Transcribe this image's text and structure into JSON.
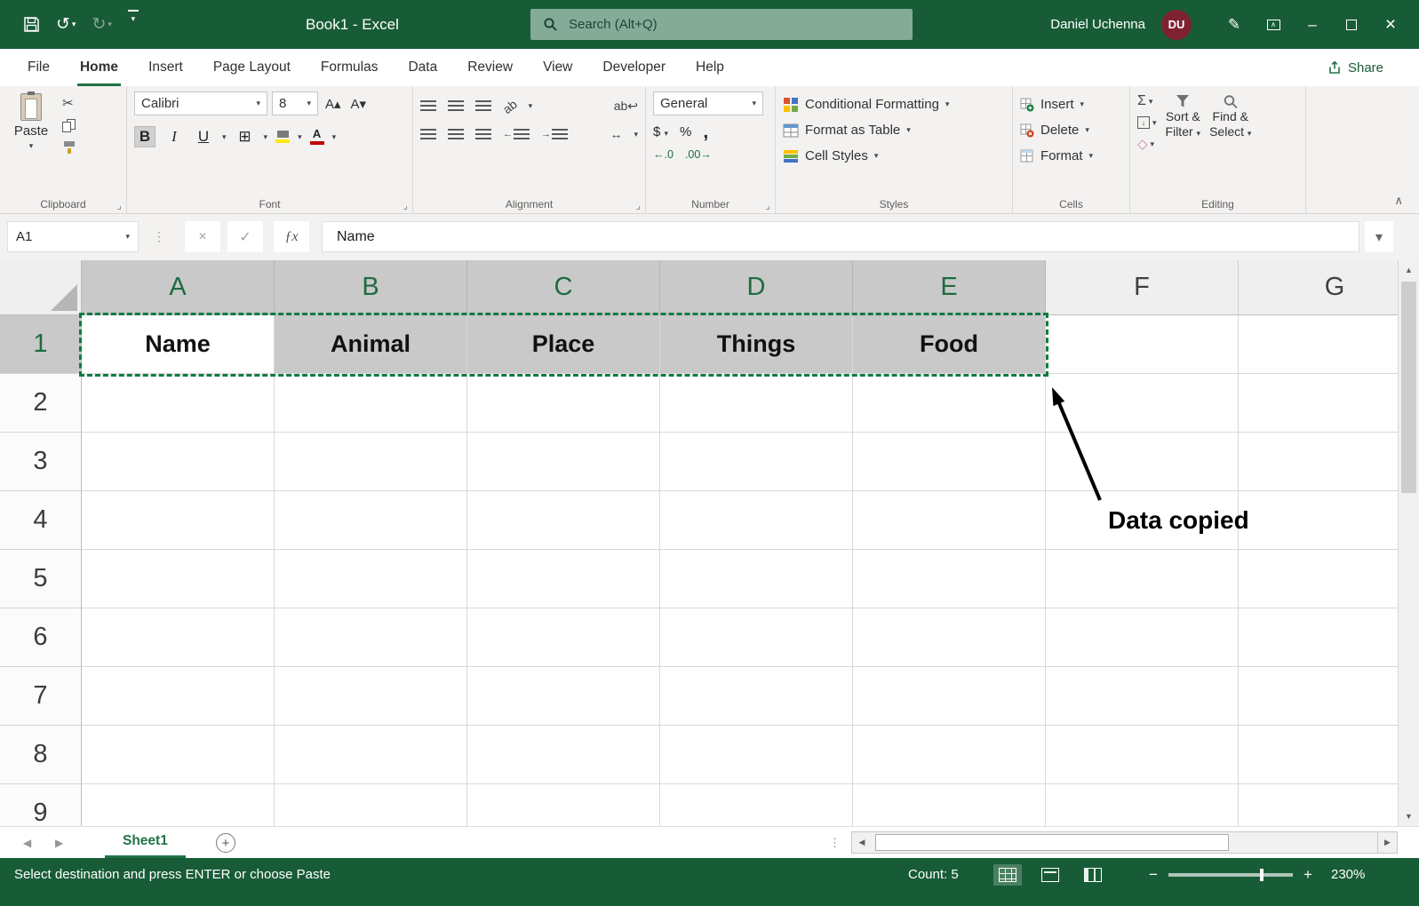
{
  "colors": {
    "title_green": "#185C37",
    "accent_green": "#217346",
    "selection_gray": "#C9C9C9",
    "avatar_red": "#7E2231",
    "fill_yellow": "#FFE812",
    "font_red": "#C00000"
  },
  "icons": {
    "chevron_down": "▾",
    "chevron_up": "∧",
    "undo": "↺",
    "redo": "↻",
    "minimize": "–",
    "close": "×",
    "cut": "✂",
    "check": "✓",
    "cancel": "×",
    "fx": "ƒx",
    "autosum": "Σ",
    "dollar": "$",
    "percent": "%",
    "comma": ",",
    "bold": "B",
    "italic": "I",
    "underline": "U",
    "dots_vertical": "⋮",
    "tri_left": "◀",
    "tri_right": "▶",
    "tri_up": "▲",
    "tri_down": "▼",
    "plus": "+",
    "minus": "−",
    "grow_font": "A▴",
    "shrink_font": "A▾",
    "orientation": "ab",
    "wrap_text": "ab↩",
    "merge_center": "↔",
    "arrow_left": "←",
    "arrow_right": "→",
    "increase_decimal": "←.0",
    "decrease_decimal": ".00→",
    "clear": "◇",
    "borders": "⊞",
    "font_color_letter": "A",
    "launcher": "⌟",
    "pen": "✎",
    "fill_down": "↓"
  },
  "titlebar": {
    "title": "Book1  -  Excel",
    "search_placeholder": "Search (Alt+Q)",
    "user_name": "Daniel Uchenna",
    "user_initials": "DU"
  },
  "tabs": {
    "items": [
      "File",
      "Home",
      "Insert",
      "Page Layout",
      "Formulas",
      "Data",
      "Review",
      "View",
      "Developer",
      "Help"
    ],
    "share": "Share"
  },
  "ribbon": {
    "paste": "Paste",
    "font_name": "Calibri",
    "font_size": "8",
    "number_format": "General",
    "conditional_formatting": "Conditional Formatting",
    "format_as_table": "Format as Table",
    "cell_styles": "Cell Styles",
    "insert": "Insert",
    "delete": "Delete",
    "format": "Format",
    "sort_line1": "Sort &",
    "sort_line2": "Filter",
    "find_line1": "Find &",
    "find_line2": "Select",
    "labels": {
      "clipboard": "Clipboard",
      "font": "Font",
      "alignment": "Alignment",
      "number": "Number",
      "styles": "Styles",
      "cells": "Cells",
      "editing": "Editing"
    }
  },
  "formula_bar": {
    "name_box": "A1",
    "content": "Name"
  },
  "grid": {
    "columns": [
      "A",
      "B",
      "C",
      "D",
      "E",
      "F",
      "G"
    ],
    "rows": [
      "1",
      "2",
      "3",
      "4",
      "5",
      "6",
      "7",
      "8",
      "9"
    ],
    "values": [
      "Name",
      "Animal",
      "Place",
      "Things",
      "Food"
    ]
  },
  "annotation": {
    "text": "Data copied"
  },
  "sheetbar": {
    "sheet": "Sheet1"
  },
  "statusbar": {
    "message": "Select destination and press ENTER or choose Paste",
    "count": "Count: 5",
    "zoom": "230%"
  }
}
